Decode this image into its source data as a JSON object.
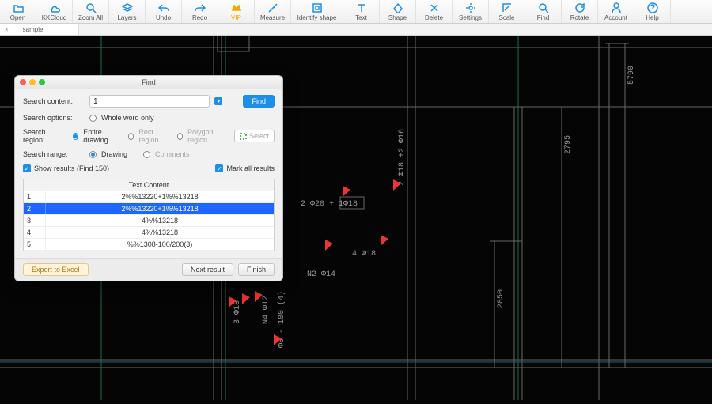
{
  "toolbar": [
    {
      "id": "open",
      "label": "Open"
    },
    {
      "id": "kkcloud",
      "label": "KKCloud"
    },
    {
      "id": "zoom-all",
      "label": "Zoom All"
    },
    {
      "id": "layers",
      "label": "Layers"
    },
    {
      "id": "undo",
      "label": "Undo"
    },
    {
      "id": "redo",
      "label": "Redo"
    },
    {
      "id": "vip",
      "label": "VIP",
      "vip": true
    },
    {
      "id": "measure",
      "label": "Measure"
    },
    {
      "id": "identify-shape",
      "label": "Identify shape",
      "wide": true
    },
    {
      "id": "text",
      "label": "Text"
    },
    {
      "id": "shape",
      "label": "Shape"
    },
    {
      "id": "delete",
      "label": "Delete"
    },
    {
      "id": "settings",
      "label": "Settings"
    },
    {
      "id": "scale",
      "label": "Scale"
    },
    {
      "id": "find",
      "label": "Find"
    },
    {
      "id": "rotate",
      "label": "Rotate"
    },
    {
      "id": "account",
      "label": "Account"
    },
    {
      "id": "help",
      "label": "Help"
    }
  ],
  "tab": {
    "close": "×",
    "title": "sample"
  },
  "dlg": {
    "title": "Find",
    "labels": {
      "content": "Search content:",
      "options": "Search options:",
      "region": "Search region:",
      "range": "Search range:"
    },
    "input_value": "1",
    "find_btn": "Find",
    "whole_word": "Whole word only",
    "regions": {
      "entire": "Entire drawing",
      "rect": "Rect region",
      "polygon": "Polygon region",
      "select": "Select"
    },
    "ranges": {
      "drawing": "Drawing",
      "comments": "Comments"
    },
    "show_results": "Show results (Find 150)",
    "mark_all": "Mark all results",
    "tbl_header": "Text Content",
    "rows": [
      {
        "n": "1",
        "txt": "2%%13220+1%%13218"
      },
      {
        "n": "2",
        "txt": "2%%13220+1%%13218",
        "sel": true
      },
      {
        "n": "3",
        "txt": "4%%13218"
      },
      {
        "n": "4",
        "txt": "4%%13218"
      },
      {
        "n": "5",
        "txt": "%%1308-100/200(3)"
      }
    ],
    "export": "Export to Excel",
    "next": "Next result",
    "finish": "Finish"
  },
  "cad_text": {
    "t1": "2 Φ20 + 1Φ18",
    "t2": "4 Φ18",
    "t3": "N2 Φ14",
    "t4": "2 Φ18 +2 Φ16",
    "t5": "5790",
    "t6": "2795",
    "t7": "2850",
    "t8": "3 Φ18",
    "t9": "N4 Φ12",
    "t10": "Φ8 - 100 (4)"
  }
}
